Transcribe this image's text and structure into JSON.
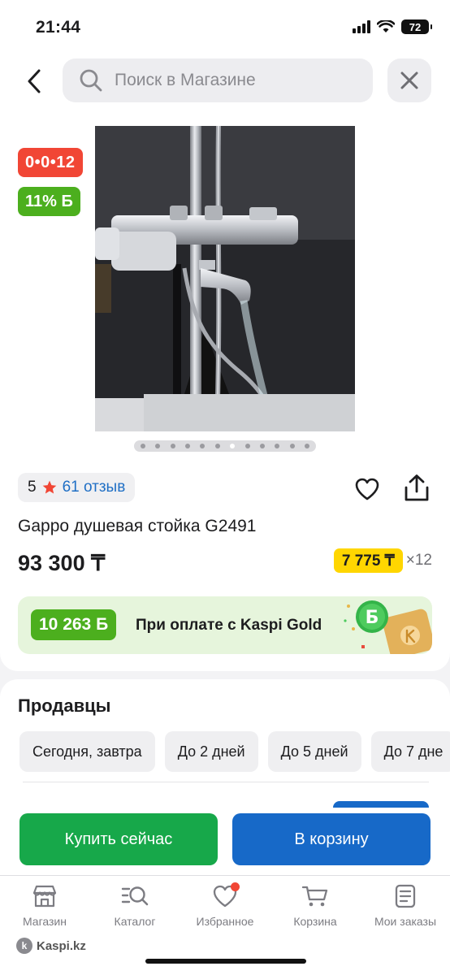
{
  "status_bar": {
    "time": "21:44",
    "battery": "72"
  },
  "header": {
    "search_placeholder": "Поиск в Магазине"
  },
  "product": {
    "promo_badge": "0•0•12",
    "bonus_badge": "11% Б",
    "rating": "5",
    "reviews": "61 отзыв",
    "title": "Gappo душевая стойка G2491",
    "price": "93 300 ₸",
    "installment_amount": "7 775 ₸",
    "installment_months": "×12",
    "gallery_count": 12,
    "gallery_active_index": 6
  },
  "gold_banner": {
    "bonus_amount": "10 263 Б",
    "text": "При оплате с Kaspi Gold"
  },
  "sellers": {
    "title": "Продавцы",
    "chips": [
      "Сегодня, завтра",
      "До 2 дней",
      "До 5 дней",
      "До 7 дне"
    ]
  },
  "actions": {
    "buy_now": "Купить сейчас",
    "add_to_cart": "В корзину"
  },
  "tabbar": {
    "items": [
      {
        "label": "Магазин",
        "icon": "shop-icon"
      },
      {
        "label": "Каталог",
        "icon": "catalog-search-icon"
      },
      {
        "label": "Избранное",
        "icon": "heart-icon"
      },
      {
        "label": "Корзина",
        "icon": "cart-icon"
      },
      {
        "label": "Мои заказы",
        "icon": "orders-icon"
      }
    ]
  },
  "watermark": "Kaspi.kz",
  "colors": {
    "kaspi_red": "#f14635",
    "green": "#4caf1e",
    "buy_green": "#17a84a",
    "blue": "#1769c8",
    "yellow": "#ffd600"
  }
}
